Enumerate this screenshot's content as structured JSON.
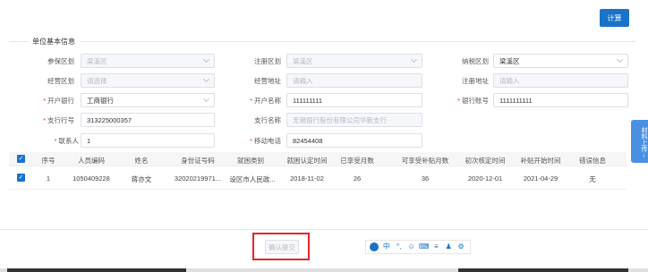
{
  "toolbar": {
    "calc_label": "计算"
  },
  "section": {
    "title": "单位基本信息"
  },
  "form": {
    "canbao_label": "参保区划",
    "canbao_value": "梁溪区",
    "zhuce_label": "注册区划",
    "zhuce_value": "梁溪区",
    "nashui_label": "纳税区划",
    "nashui_value": "梁溪区",
    "jingying_label": "经营区划",
    "jingying_placeholder": "请选择",
    "jydz_label": "经营地址",
    "jydz_placeholder": "请输入",
    "zcdz_label": "注册地址",
    "zcdz_placeholder": "请输入",
    "kaihu_label": "开户银行",
    "kaihu_value": "工商银行",
    "khmc_label": "开户名称",
    "khmc_value": "111111111",
    "yhzh_label": "银行账号",
    "yhzh_value": "1111111111",
    "zhhh_label": "支行行号",
    "zhhh_value": "313225000357",
    "zhmc_label": "支行名称",
    "zhmc_value": "无锡银行股份有限公司华新支行",
    "lxr_label": "联系人",
    "lxr_value": "1",
    "yddh_label": "移动电话",
    "yddh_value": "82454408"
  },
  "table": {
    "headers": [
      "序号",
      "人员编码",
      "姓名",
      "身份证号码",
      "就困类别",
      "就困认定时间",
      "已享受月数",
      "可享受补贴月数",
      "初次核定时间",
      "补贴开始时间",
      "错误信息"
    ],
    "rows": [
      [
        "1",
        "1050409228",
        "蒋亦文",
        "32020219971...",
        "设区市人民政...",
        "2018-11-02",
        "26",
        "36",
        "2020-12-01",
        "2021-04-29",
        "无"
      ]
    ]
  },
  "footer": {
    "confirm_label": "确认提交"
  },
  "side_tab": {
    "label": "材料上传→"
  },
  "ime": {
    "items": [
      "中",
      "°,",
      "☺",
      "⌨",
      "≡",
      "♟",
      "⚙"
    ]
  }
}
